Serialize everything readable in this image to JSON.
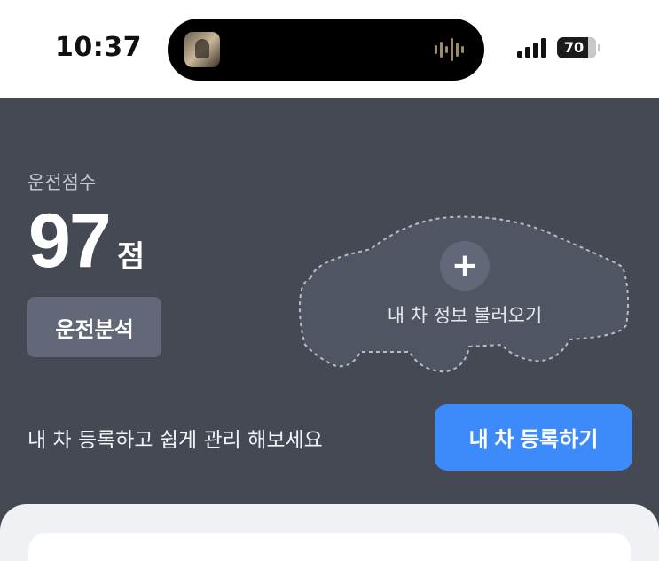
{
  "status_bar": {
    "time": "10:37",
    "battery_level": "70"
  },
  "driving": {
    "score_label": "운전점수",
    "score_value": "97",
    "score_unit": "점",
    "analysis_button": "운전분석"
  },
  "car": {
    "load_info_label": "내 차 정보 불러오기",
    "plus_symbol": "+"
  },
  "register": {
    "hint": "내 차 등록하고 쉽게 관리 해보세요",
    "button_label": "내 차 등록하기"
  },
  "colors": {
    "panel_bg": "#444954",
    "accent_blue": "#3d8bfa",
    "secondary_button": "#626877"
  }
}
